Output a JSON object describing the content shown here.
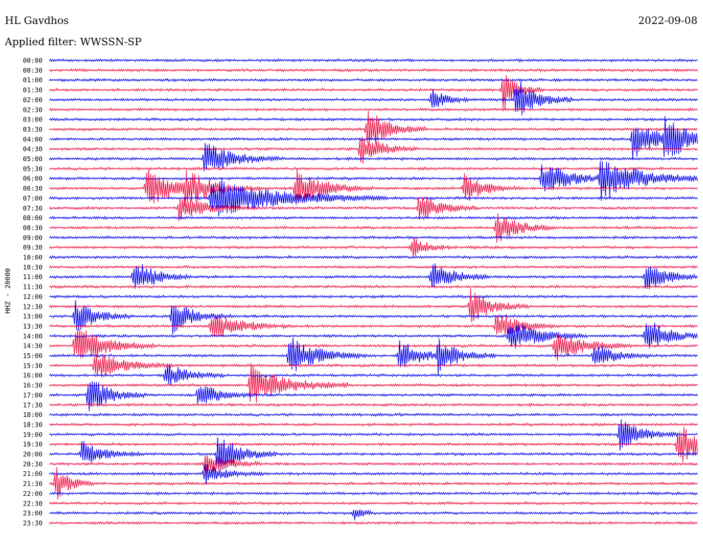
{
  "header": {
    "station": "HL Gavdhos",
    "date": "2022-09-08",
    "filter": "Applied filter: WWSSN-SP"
  },
  "colors": {
    "trace_a": "#0000ee",
    "trace_b": "#ee1144"
  },
  "chart_data": {
    "type": "seismogram-helicorder",
    "station": "HL Gavdhos",
    "date": "2022-09-08",
    "filter": "WWSSN-SP",
    "ylabel": "HHZ - 20000",
    "row_interval_minutes": 30,
    "row_labels": [
      "00:00",
      "00:30",
      "01:00",
      "01:30",
      "02:00",
      "02:30",
      "03:00",
      "03:30",
      "04:00",
      "04:30",
      "05:00",
      "05:30",
      "06:00",
      "06:30",
      "07:00",
      "07:30",
      "08:00",
      "08:30",
      "09:00",
      "09:30",
      "10:00",
      "10:30",
      "11:00",
      "11:30",
      "12:00",
      "12:30",
      "13:00",
      "13:30",
      "14:00",
      "14:30",
      "15:00",
      "15:30",
      "16:00",
      "16:30",
      "17:00",
      "17:30",
      "18:00",
      "18:30",
      "19:00",
      "19:30",
      "20:00",
      "20:30",
      "21:00",
      "21:30",
      "22:00",
      "22:30",
      "23:00",
      "23:30"
    ],
    "color_cycle": [
      "blue",
      "red"
    ],
    "events": [
      {
        "row": 4,
        "pos": 0.72,
        "amp": 1.0,
        "dur": 0.03
      },
      {
        "row": 3,
        "pos": 0.7,
        "amp": 1.0,
        "dur": 0.02
      },
      {
        "row": 4,
        "pos": 0.59,
        "amp": 0.5,
        "dur": 0.02
      },
      {
        "row": 7,
        "pos": 0.49,
        "amp": 1.0,
        "dur": 0.03
      },
      {
        "row": 9,
        "pos": 0.48,
        "amp": 0.7,
        "dur": 0.03
      },
      {
        "row": 8,
        "pos": 0.9,
        "amp": 0.9,
        "dur": 0.04
      },
      {
        "row": 8,
        "pos": 0.95,
        "amp": 1.0,
        "dur": 0.03
      },
      {
        "row": 10,
        "pos": 0.24,
        "amp": 0.8,
        "dur": 0.04
      },
      {
        "row": 12,
        "pos": 0.85,
        "amp": 1.0,
        "dur": 0.06
      },
      {
        "row": 12,
        "pos": 0.76,
        "amp": 0.8,
        "dur": 0.04
      },
      {
        "row": 13,
        "pos": 0.15,
        "amp": 0.9,
        "dur": 0.04
      },
      {
        "row": 13,
        "pos": 0.21,
        "amp": 0.7,
        "dur": 0.04
      },
      {
        "row": 13,
        "pos": 0.38,
        "amp": 0.9,
        "dur": 0.04
      },
      {
        "row": 13,
        "pos": 0.64,
        "amp": 0.7,
        "dur": 0.03
      },
      {
        "row": 14,
        "pos": 0.25,
        "amp": 1.0,
        "dur": 0.09
      },
      {
        "row": 15,
        "pos": 0.2,
        "amp": 0.6,
        "dur": 0.04
      },
      {
        "row": 15,
        "pos": 0.57,
        "amp": 0.7,
        "dur": 0.03
      },
      {
        "row": 17,
        "pos": 0.69,
        "amp": 0.8,
        "dur": 0.03
      },
      {
        "row": 19,
        "pos": 0.56,
        "amp": 0.5,
        "dur": 0.02
      },
      {
        "row": 22,
        "pos": 0.13,
        "amp": 0.9,
        "dur": 0.03
      },
      {
        "row": 22,
        "pos": 0.59,
        "amp": 0.8,
        "dur": 0.03
      },
      {
        "row": 22,
        "pos": 0.92,
        "amp": 0.7,
        "dur": 0.03
      },
      {
        "row": 25,
        "pos": 0.65,
        "amp": 0.8,
        "dur": 0.03
      },
      {
        "row": 26,
        "pos": 0.04,
        "amp": 0.8,
        "dur": 0.03
      },
      {
        "row": 26,
        "pos": 0.19,
        "amp": 0.8,
        "dur": 0.03
      },
      {
        "row": 27,
        "pos": 0.25,
        "amp": 0.7,
        "dur": 0.04
      },
      {
        "row": 27,
        "pos": 0.69,
        "amp": 0.7,
        "dur": 0.03
      },
      {
        "row": 28,
        "pos": 0.71,
        "amp": 0.8,
        "dur": 0.04
      },
      {
        "row": 28,
        "pos": 0.92,
        "amp": 0.9,
        "dur": 0.03
      },
      {
        "row": 29,
        "pos": 0.04,
        "amp": 1.0,
        "dur": 0.04
      },
      {
        "row": 29,
        "pos": 0.78,
        "amp": 0.8,
        "dur": 0.04
      },
      {
        "row": 30,
        "pos": 0.37,
        "amp": 0.9,
        "dur": 0.04
      },
      {
        "row": 30,
        "pos": 0.54,
        "amp": 0.8,
        "dur": 0.03
      },
      {
        "row": 30,
        "pos": 0.6,
        "amp": 0.8,
        "dur": 0.03
      },
      {
        "row": 30,
        "pos": 0.84,
        "amp": 0.6,
        "dur": 0.03
      },
      {
        "row": 31,
        "pos": 0.07,
        "amp": 0.7,
        "dur": 0.04
      },
      {
        "row": 32,
        "pos": 0.18,
        "amp": 0.6,
        "dur": 0.03
      },
      {
        "row": 33,
        "pos": 0.31,
        "amp": 1.0,
        "dur": 0.05
      },
      {
        "row": 34,
        "pos": 0.06,
        "amp": 0.9,
        "dur": 0.03
      },
      {
        "row": 34,
        "pos": 0.23,
        "amp": 0.6,
        "dur": 0.03
      },
      {
        "row": 38,
        "pos": 0.88,
        "amp": 0.8,
        "dur": 0.03
      },
      {
        "row": 39,
        "pos": 0.97,
        "amp": 0.9,
        "dur": 0.05
      },
      {
        "row": 40,
        "pos": 0.05,
        "amp": 0.6,
        "dur": 0.03
      },
      {
        "row": 40,
        "pos": 0.26,
        "amp": 1.0,
        "dur": 0.03
      },
      {
        "row": 41,
        "pos": 0.24,
        "amp": 0.6,
        "dur": 0.03
      },
      {
        "row": 43,
        "pos": 0.01,
        "amp": 0.8,
        "dur": 0.02
      },
      {
        "row": 42,
        "pos": 0.24,
        "amp": 0.5,
        "dur": 0.03
      },
      {
        "row": 46,
        "pos": 0.47,
        "amp": 0.4,
        "dur": 0.01
      }
    ]
  }
}
